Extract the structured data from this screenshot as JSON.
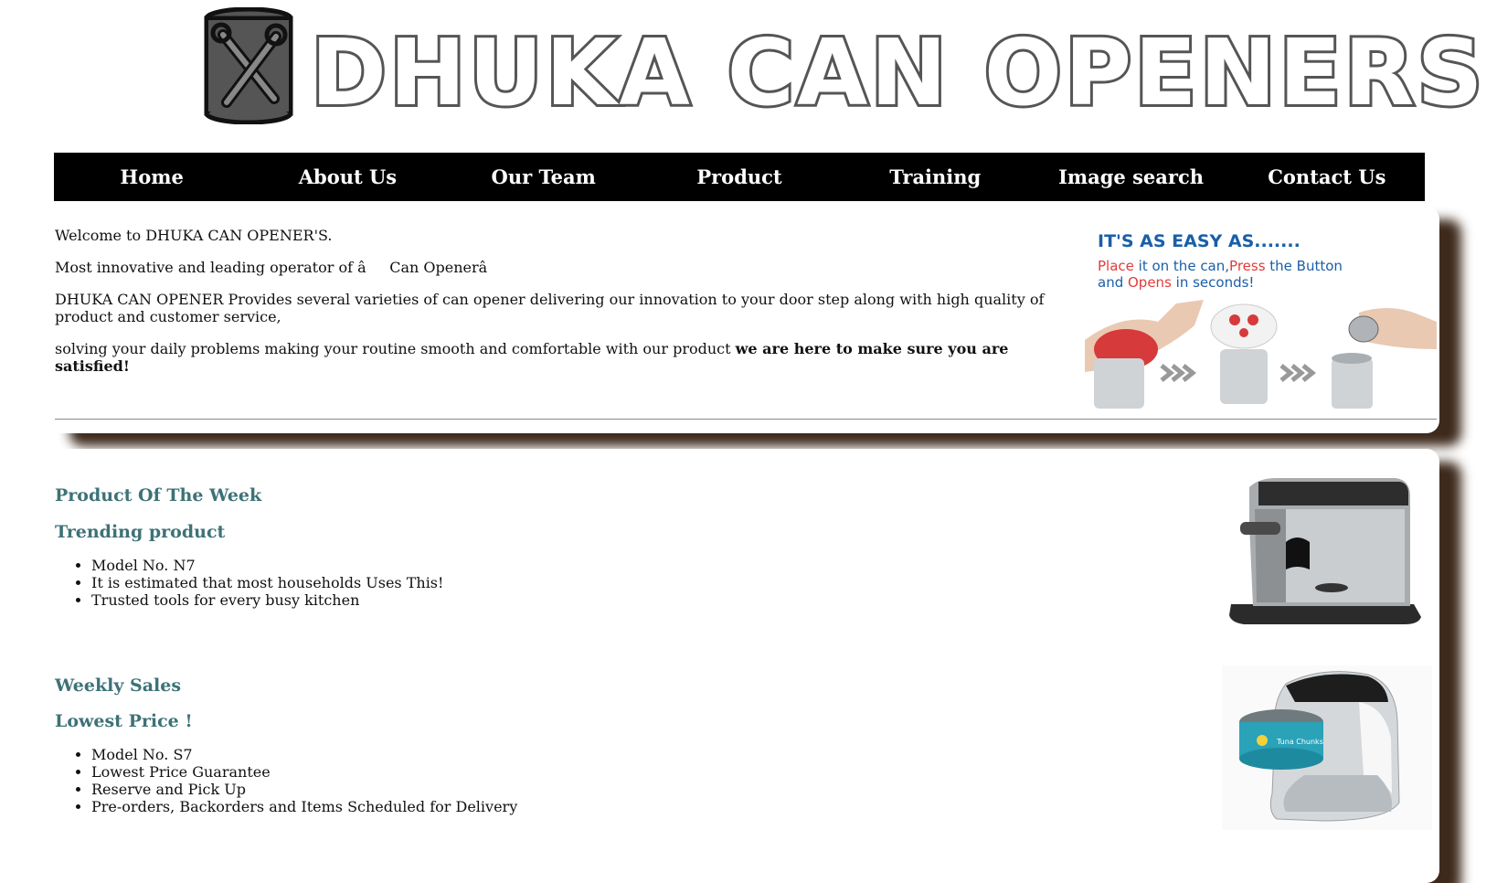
{
  "header": {
    "logo_text": "DHUKA CAN OPENERS"
  },
  "nav": {
    "items": [
      "Home",
      "About Us",
      "Our Team",
      "Product",
      "Training",
      "Image search",
      "Contact Us"
    ]
  },
  "intro": {
    "welcome": "Welcome to DHUKA CAN OPENER'S.",
    "tagline": "Most innovative and leading operator of âCan Openerâ",
    "provides": "DHUKA CAN OPENER Provides several varieties of can opener delivering our innovation to your door step along with high quality of product and customer service,",
    "solving": "solving your daily problems making your routine smooth and comfortable with our product",
    "solving_bold": "we are here to make sure you are satisfied!"
  },
  "easy_banner": {
    "title": "IT'S AS EASY AS.......",
    "line1_a": "Place",
    "line1_b": " it on the can,",
    "line1_c": "Press",
    "line1_d": " the Button",
    "line2_a": "and ",
    "line2_b": "Opens",
    "line2_c": " in seconds!"
  },
  "product_week": {
    "heading": "Product Of The Week",
    "subheading": "Trending product",
    "bullets": [
      "Model No. N7",
      "It is estimated that most households Uses This!",
      "Trusted tools for every busy kitchen"
    ]
  },
  "weekly_sales": {
    "heading": "Weekly Sales",
    "subheading": "Lowest Price !",
    "bullets": [
      "Model No. S7",
      "Lowest Price Guarantee",
      "Reserve and Pick Up",
      "Pre-orders, Backorders and Items Scheduled for Delivery"
    ]
  },
  "colors": {
    "heading_teal": "#3d7277",
    "nav_bg": "#000000",
    "shadow_brown": "#3e2a1c",
    "logo_gray": "#555555",
    "banner_blue": "#1a5fa8",
    "banner_red": "#e23b3b"
  }
}
